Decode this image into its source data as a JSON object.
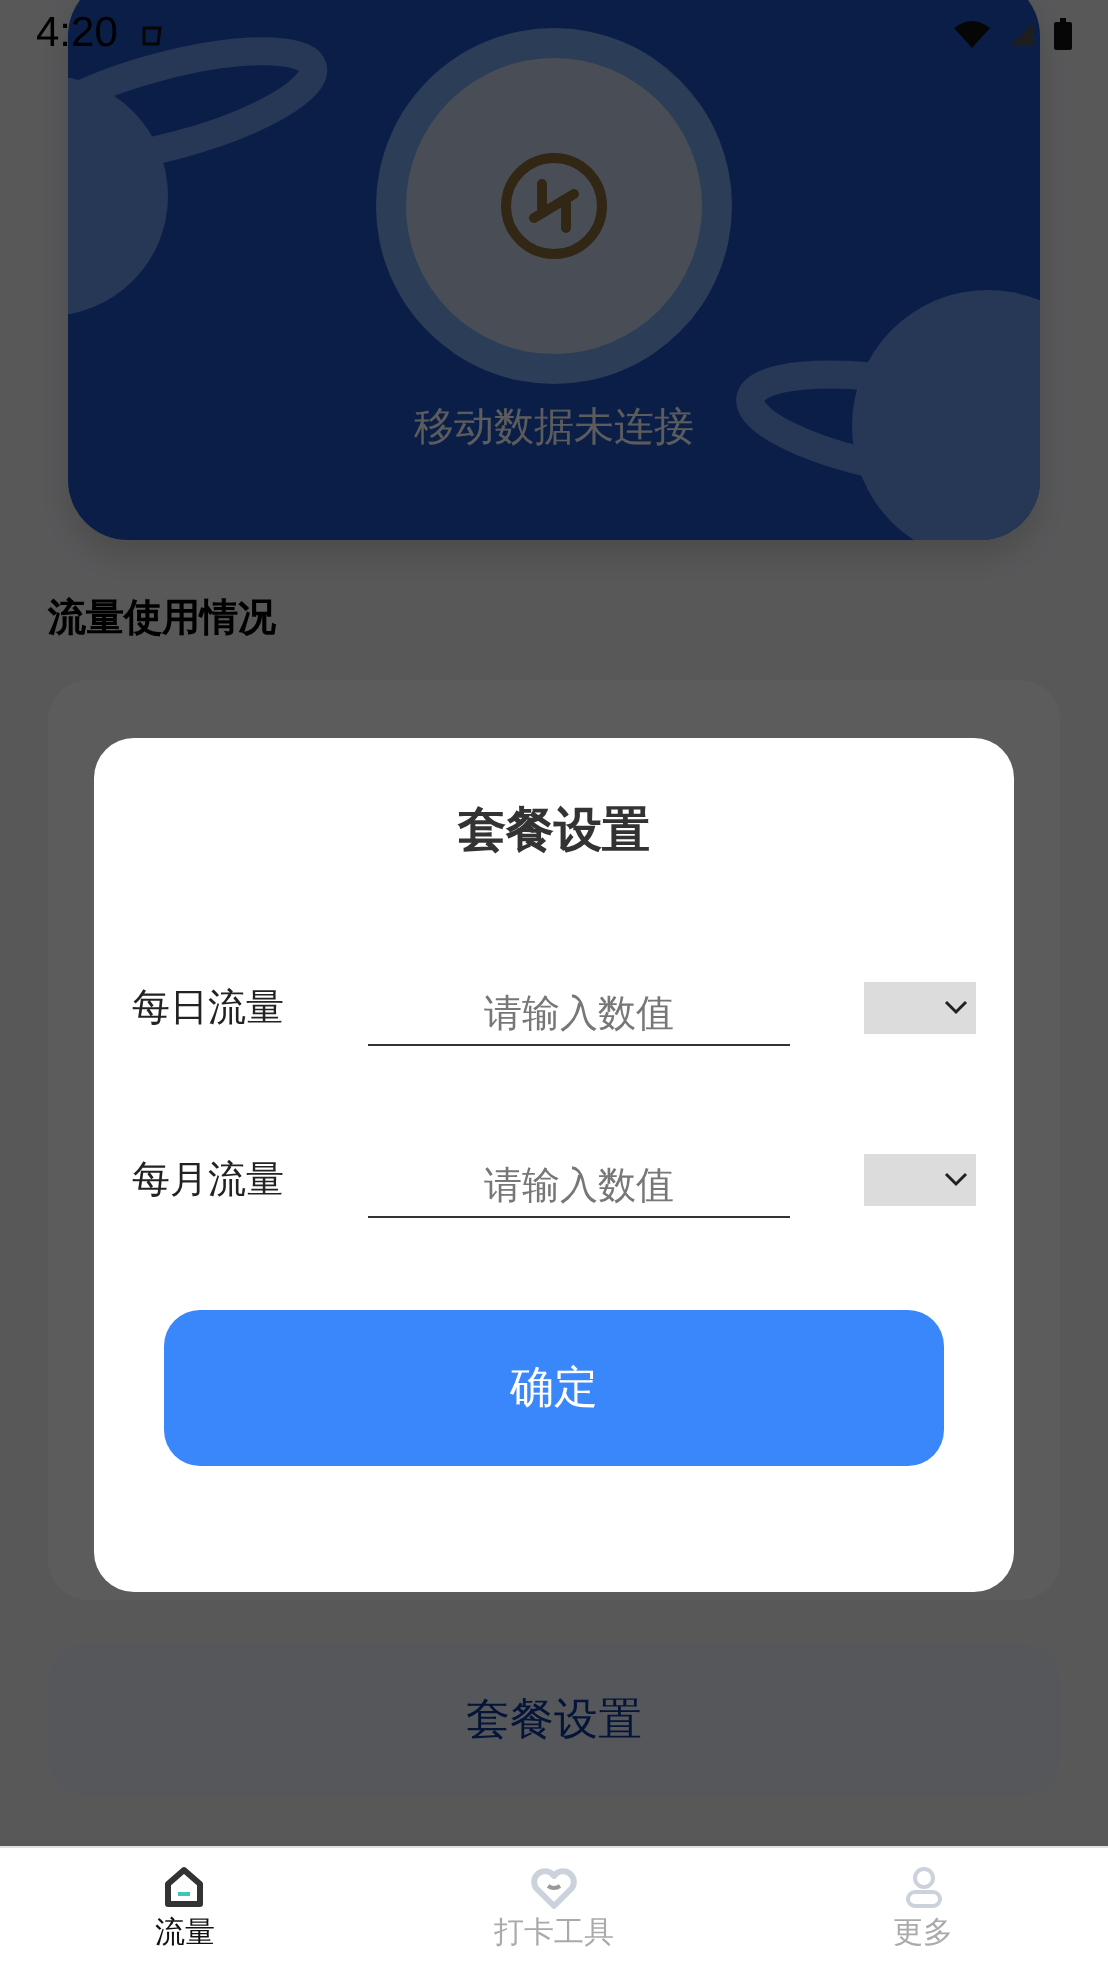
{
  "status_bar": {
    "time": "4:20"
  },
  "hero": {
    "status": "移动数据未连接"
  },
  "section_title": "流量使用情况",
  "plan_button": "套餐设置",
  "dialog": {
    "title": "套餐设置",
    "fields": [
      {
        "label": "每日流量",
        "placeholder": "请输入数值"
      },
      {
        "label": "每月流量",
        "placeholder": "请输入数值"
      }
    ],
    "confirm": "确定"
  },
  "tabs": [
    {
      "label": "流量",
      "selected": true
    },
    {
      "label": "打卡工具",
      "selected": false
    },
    {
      "label": "更多",
      "selected": false
    }
  ]
}
